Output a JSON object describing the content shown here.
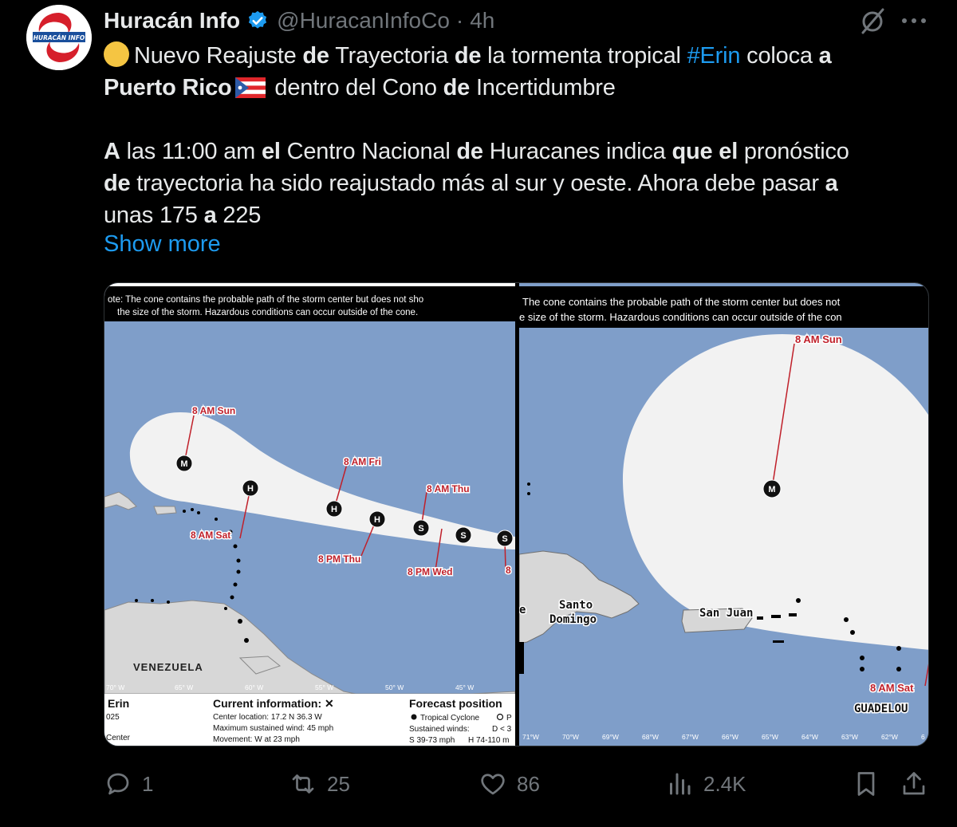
{
  "author": {
    "display_name": "Huracán Info",
    "handle": "@HuracanInfoCo",
    "separator": "·",
    "time": "4h",
    "avatar_text": "HURACÁN INFO"
  },
  "icons": {
    "verified": "verified-badge-icon",
    "grok": "grok-icon",
    "more": "more-icon",
    "reply": "reply-icon",
    "retweet": "retweet-icon",
    "like": "heart-icon",
    "views": "views-icon",
    "bookmark": "bookmark-icon",
    "share": "share-icon"
  },
  "tweet_text": {
    "p1": {
      "s1": "Nuevo Reajuste ",
      "s2": "de",
      "s3": " Trayectoria ",
      "s4": "de",
      "s5": " la tormenta tropical ",
      "hashtag": "#Erin",
      "s6": " coloca ",
      "s7": "a",
      "s8": "Puerto Rico",
      "s9": " dentro del Cono ",
      "s10": "de",
      "s11": " Incertidumbre"
    },
    "p2": {
      "s1": "A",
      "s2": " las 11:00 am ",
      "s3": "el",
      "s4": " Centro Nacional ",
      "s5": "de",
      "s6": " Huracanes indica ",
      "s7": "que el",
      "s8": " pronóstico",
      "s9": "de",
      "s10": " trayectoria ha sido reajustado más al sur y oeste. Ahora debe pasar ",
      "s11": "a",
      "s12": "unas 175 ",
      "s13": "a",
      "s14": " 225"
    },
    "show_more": "Show more"
  },
  "map_left": {
    "note_line1": "ote: The cone contains the probable path of the storm center but does not sho",
    "note_line2": "the size of the storm. Hazardous conditions can occur outside of the cone.",
    "labels": {
      "sun": "8 AM Sun",
      "sat": "8 AM Sat",
      "fri": "8 AM Fri",
      "thu_pm": "8 PM Thu",
      "thu_am": "8 AM Thu",
      "wed_pm": "8 PM Wed",
      "edge": "8"
    },
    "markers": {
      "m": "M",
      "h": "H",
      "s": "S"
    },
    "country": "VENEZUELA",
    "lon_ticks": [
      "70° W",
      "65° W",
      "60° W",
      "55° W",
      "50° W",
      "45° W"
    ],
    "footer": {
      "storm": "Erin",
      "year": "025",
      "center": "Center",
      "current_title": "Current information: ✕",
      "center_location": "Center location: 17.2 N 36.3 W",
      "max_wind": "Maximum sustained wind: 45 mph",
      "movement": "Movement: W at 23 mph",
      "forecast_title": "Forecast position",
      "legend_cyclone": "Tropical Cyclone",
      "legend_p": "P",
      "sustained": "Sustained winds:",
      "d_lt": "D < 3",
      "s_range": "S 39-73 mph",
      "h_range": "H 74-110 m"
    }
  },
  "map_right": {
    "note_line1": "The cone contains the probable path of the storm center but does not",
    "note_line2": "e size of the storm. Hazardous conditions can occur outside of the con",
    "labels": {
      "sun": "8 AM Sun",
      "sat": "8 AM Sat"
    },
    "marker": "M",
    "places": {
      "santo": "Santo",
      "domingo": "Domingo",
      "san_juan": "San Juan",
      "guadeloupe": "GUADELOU",
      "edge": "e"
    },
    "lon_ticks": [
      "71°W",
      "70°W",
      "69°W",
      "68°W",
      "67°W",
      "66°W",
      "65°W",
      "64°W",
      "63°W",
      "62°W",
      "6"
    ]
  },
  "stats": {
    "replies": "1",
    "retweets": "25",
    "likes": "86",
    "views": "2.4K"
  },
  "colors": {
    "background": "#000000",
    "text": "#e7e9ea",
    "muted": "#71767b",
    "link": "#1d9bf0",
    "ocean": "#7f9ec9",
    "land": "#d7d7d7",
    "cone": "#f2f2f2"
  }
}
